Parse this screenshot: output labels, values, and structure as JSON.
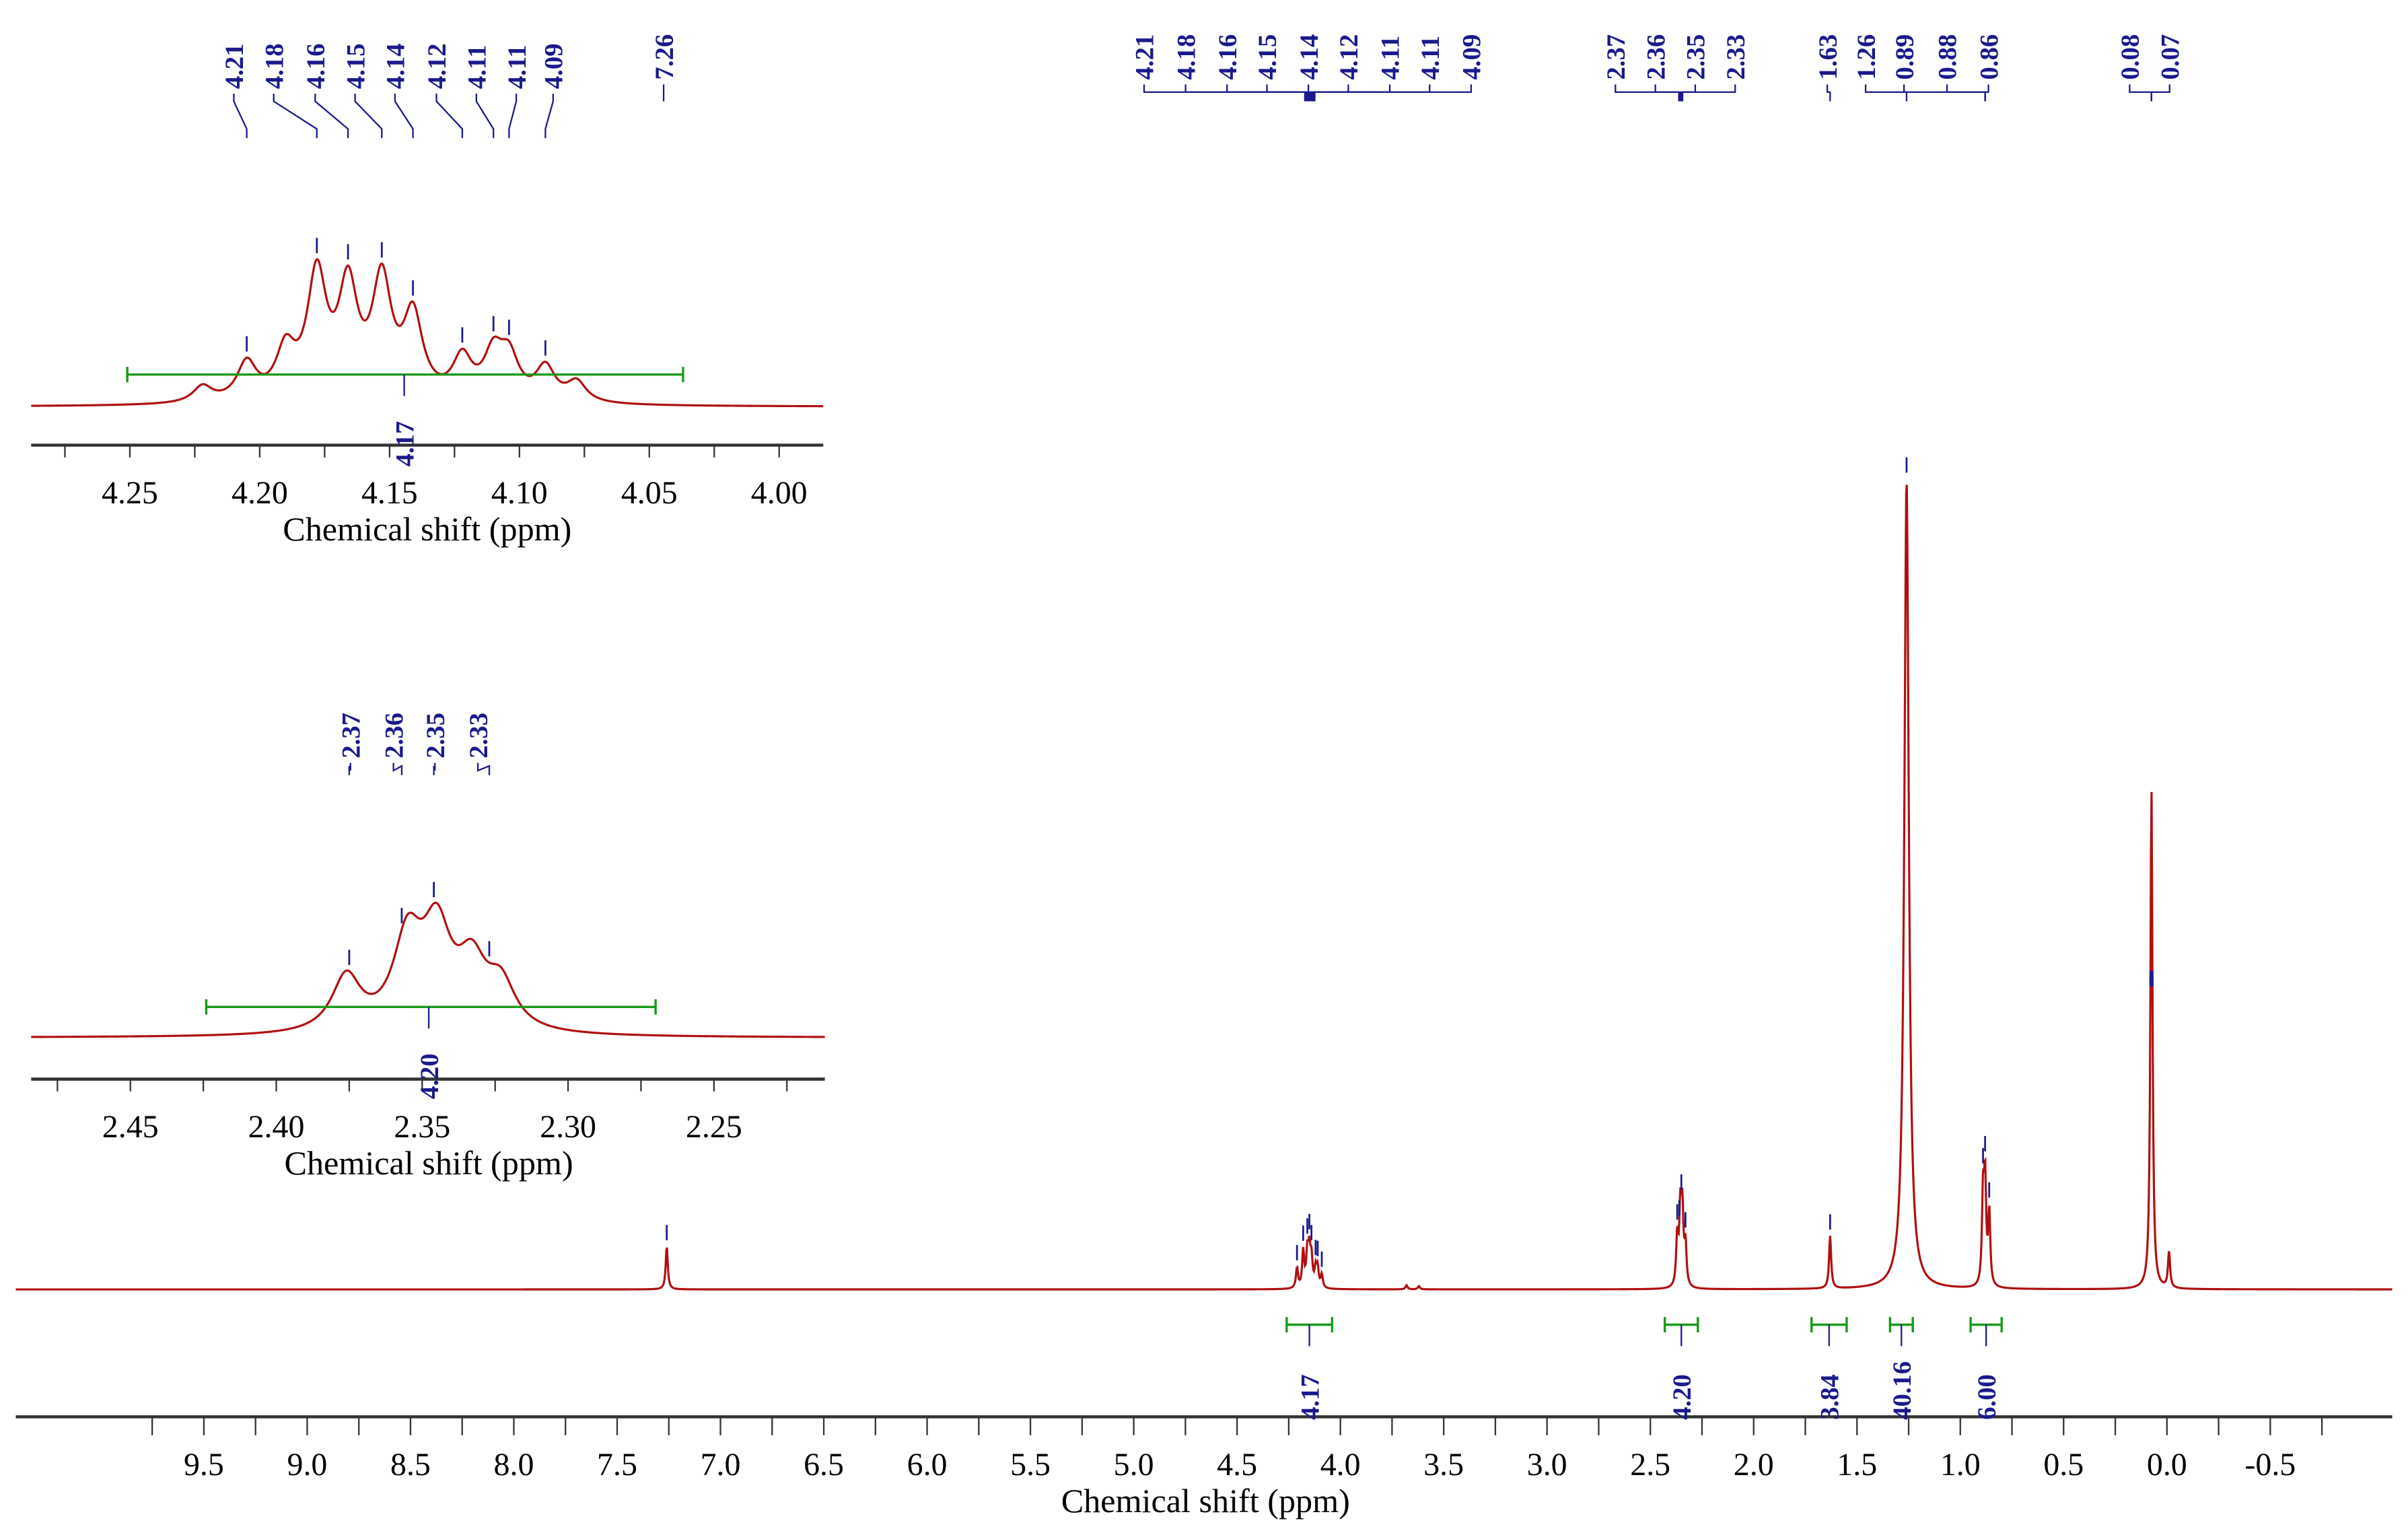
{
  "chart_data": [
    {
      "id": "main",
      "type": "line",
      "title": "",
      "xlabel": "Chemical shift (ppm)",
      "ylabel": "",
      "xlim": [
        10.41,
        -1.09
      ],
      "grid": false,
      "xticks": [
        "9.5",
        "9.0",
        "8.5",
        "8.0",
        "7.5",
        "7.0",
        "6.5",
        "6.0",
        "5.5",
        "5.0",
        "4.5",
        "4.0",
        "3.5",
        "3.0",
        "2.5",
        "2.0",
        "1.5",
        "1.0",
        "0.5",
        "0.0",
        "-0.5"
      ],
      "peaks": [
        {
          "ppm": 7.26,
          "height": 5.3
        },
        {
          "ppm": 4.21,
          "height": 2.5
        },
        {
          "ppm": 4.18,
          "height": 4.5
        },
        {
          "ppm": 4.16,
          "height": 4.2
        },
        {
          "ppm": 4.15,
          "height": 4.3
        },
        {
          "ppm": 4.14,
          "height": 3.4
        },
        {
          "ppm": 4.12,
          "height": 2.2
        },
        {
          "ppm": 4.11,
          "height": 2.3
        },
        {
          "ppm": 4.09,
          "height": 1.6
        },
        {
          "ppm": 3.68,
          "height": 0.5
        },
        {
          "ppm": 3.62,
          "height": 0.4
        },
        {
          "ppm": 2.37,
          "height": 6
        },
        {
          "ppm": 2.355,
          "height": 9
        },
        {
          "ppm": 2.345,
          "height": 9
        },
        {
          "ppm": 2.33,
          "height": 5
        },
        {
          "ppm": 1.63,
          "height": 6.5
        },
        {
          "ppm": 1.26,
          "height": 100,
          "width": 0.013
        },
        {
          "ppm": 0.89,
          "height": 11
        },
        {
          "ppm": 0.88,
          "height": 12.5
        },
        {
          "ppm": 0.86,
          "height": 9
        },
        {
          "ppm": 0.075,
          "height": 62
        },
        {
          "ppm": -0.01,
          "height": 4.5
        }
      ],
      "peak_labels": [
        [
          "4.21",
          "4.18",
          "4.16",
          "4.15",
          "4.14",
          "4.12",
          "4.11",
          "4.11",
          "4.09"
        ],
        [
          "2.37",
          "2.36",
          "2.35",
          "2.33"
        ],
        [
          "1.63",
          "1.26",
          "0.89",
          "0.88",
          "0.86"
        ],
        [
          "0.08",
          "0.07"
        ]
      ],
      "integrals": [
        {
          "from": 4.26,
          "to": 4.04,
          "value": "4.17"
        },
        {
          "from": 2.43,
          "to": 2.27,
          "value": "4.20"
        },
        {
          "from": 1.72,
          "to": 1.55,
          "value": "3.84"
        },
        {
          "from": 1.34,
          "to": 1.23,
          "value": "40.16"
        },
        {
          "from": 0.95,
          "to": 0.8,
          "value": "6.00"
        }
      ]
    },
    {
      "id": "inset-4.1",
      "type": "line",
      "xlabel": "Chemical shift (ppm)",
      "xlim": [
        4.288,
        3.983
      ],
      "xticks": [
        "4.25",
        "4.20",
        "4.15",
        "4.10",
        "4.05",
        "4.00"
      ],
      "peaks": [
        {
          "ppm": 4.222,
          "height": 0.12
        },
        {
          "ppm": 4.205,
          "height": 0.28
        },
        {
          "ppm": 4.19,
          "height": 0.35
        },
        {
          "ppm": 4.178,
          "height": 0.9
        },
        {
          "ppm": 4.166,
          "height": 0.8
        },
        {
          "ppm": 4.153,
          "height": 0.85
        },
        {
          "ppm": 4.141,
          "height": 0.6
        },
        {
          "ppm": 4.122,
          "height": 0.3
        },
        {
          "ppm": 4.11,
          "height": 0.32
        },
        {
          "ppm": 4.104,
          "height": 0.3
        },
        {
          "ppm": 4.09,
          "height": 0.25
        },
        {
          "ppm": 4.078,
          "height": 0.15
        }
      ],
      "peak_labels": [
        "4.21",
        "4.18",
        "4.16",
        "4.15",
        "4.14",
        "4.12",
        "4.11",
        "4.11",
        "4.09"
      ],
      "label_ppm": [
        4.205,
        4.178,
        4.166,
        4.153,
        4.141,
        4.122,
        4.11,
        4.104,
        4.09
      ],
      "extra_label": "7.26",
      "integral": {
        "from": 4.251,
        "to": 4.037,
        "value": "4.17"
      }
    },
    {
      "id": "inset-2.35",
      "type": "line",
      "xlabel": "Chemical shift (ppm)",
      "xlim": [
        2.484,
        2.212
      ],
      "xticks": [
        "2.45",
        "2.40",
        "2.35",
        "2.30",
        "2.25"
      ],
      "peaks": [
        {
          "ppm": 2.376,
          "height": 0.5
        },
        {
          "ppm": 2.355,
          "height": 0.8
        },
        {
          "ppm": 2.345,
          "height": 0.85
        },
        {
          "ppm": 2.333,
          "height": 0.55
        },
        {
          "ppm": 2.323,
          "height": 0.4
        }
      ],
      "peak_labels": [
        "2.37",
        "2.36",
        "2.35",
        "2.33"
      ],
      "label_ppm": [
        2.375,
        2.357,
        2.346,
        2.327
      ],
      "integral": {
        "from": 2.424,
        "to": 2.27,
        "value": "4.20"
      }
    }
  ],
  "colors": {
    "spectrum": "#b01010",
    "labels": "#1a1a8c",
    "integral": "#1a9a1a"
  }
}
